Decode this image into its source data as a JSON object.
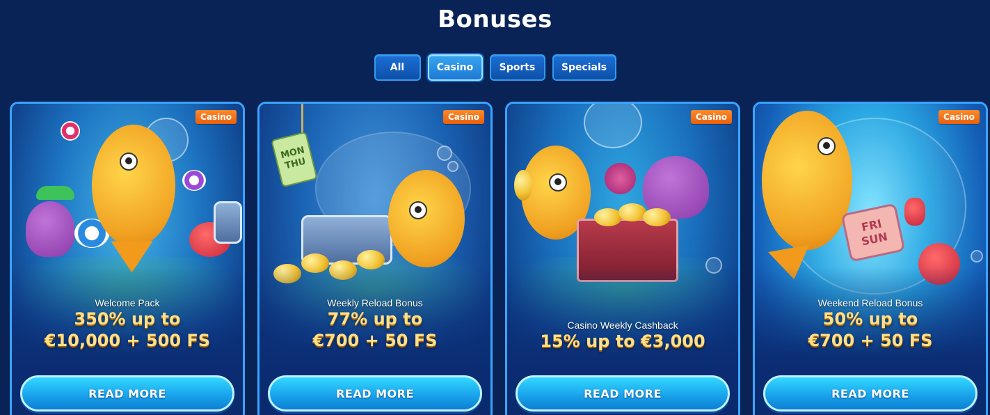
{
  "page": {
    "title": "Bonuses"
  },
  "filters": {
    "tabs": [
      {
        "label": "All",
        "active": false
      },
      {
        "label": "Casino",
        "active": true
      },
      {
        "label": "Sports",
        "active": false
      },
      {
        "label": "Specials",
        "active": false
      }
    ]
  },
  "cards": [
    {
      "badge": "Casino",
      "name": "Welcome Pack",
      "offer_line1": "350% up to",
      "offer_line2": "€10,000 + 500 FS",
      "button": "READ MORE"
    },
    {
      "badge": "Casino",
      "name": "Weekly Reload Bonus",
      "offer_line1": "77% up to",
      "offer_line2": "€700 + 50 FS",
      "button": "READ MORE",
      "art_text": [
        "MON",
        "THU"
      ]
    },
    {
      "badge": "Casino",
      "name": "Casino Weekly Cashback",
      "offer_line1": "15% up to €3,000",
      "button": "READ MORE"
    },
    {
      "badge": "Casino",
      "name": "Weekend Reload Bonus",
      "offer_line1": "50% up to",
      "offer_line2": "€700 + 50 FS",
      "button": "READ MORE",
      "art_text": [
        "FRI",
        "SUN"
      ]
    }
  ],
  "colors": {
    "background": "#0a2356",
    "badge": "#f0701a",
    "offer_text": "#ffe08a",
    "button": "#1aa4ec"
  }
}
